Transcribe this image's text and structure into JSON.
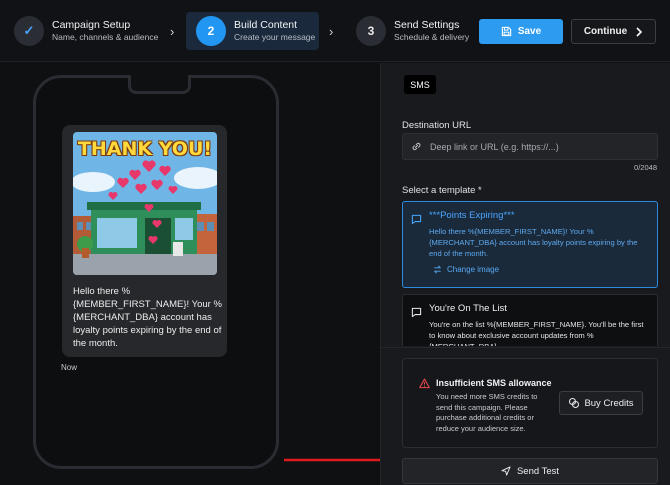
{
  "stepper": {
    "steps": [
      {
        "title": "Campaign Setup",
        "subtitle": "Name, channels & audience",
        "marker": "✓",
        "state": "done"
      },
      {
        "title": "Build Content",
        "subtitle": "Create your message",
        "marker": "2",
        "state": "active"
      },
      {
        "title": "Send Settings",
        "subtitle": "Schedule & delivery",
        "marker": "3",
        "state": "pending"
      }
    ],
    "save_label": "Save",
    "continue_label": "Continue"
  },
  "preview": {
    "image_caption": "THANK YOU!",
    "message": "Hello there %{MEMBER_FIRST_NAME}! Your %{MERCHANT_DBA} account has loyalty points expiring by the end of the month.",
    "timestamp": "Now"
  },
  "sms": {
    "tab_label": "SMS",
    "destination_label": "Destination URL",
    "destination_placeholder": "Deep link or URL (e.g. https://...)",
    "destination_value": "",
    "char_counter": "0/2048",
    "template_label": "Select a template *",
    "templates": [
      {
        "title": "***Points Expiring***",
        "body": "Hello there %{MEMBER_FIRST_NAME}! Your %{MERCHANT_DBA} account has loyalty points expiring by the end of the month.",
        "action": "Change image",
        "selected": true
      },
      {
        "title": "You're On The List",
        "body": "You're on the list %{MEMBER_FIRST_NAME}. You'll be the first to know about exclusive account updates from %{MERCHANT_DBA}.",
        "selected": false
      }
    ],
    "alert": {
      "title": "Insufficient SMS allowance",
      "body": "You need more SMS credits to send this campaign. Please purchase additional credits or reduce your audience size.",
      "action": "Buy Credits"
    },
    "send_test_label": "Send Test"
  },
  "colors": {
    "accent": "#2d9cf0",
    "selected_template_border": "#2b8be0",
    "warning": "#e5484d",
    "annotation_arrow": "#e01b1b"
  }
}
